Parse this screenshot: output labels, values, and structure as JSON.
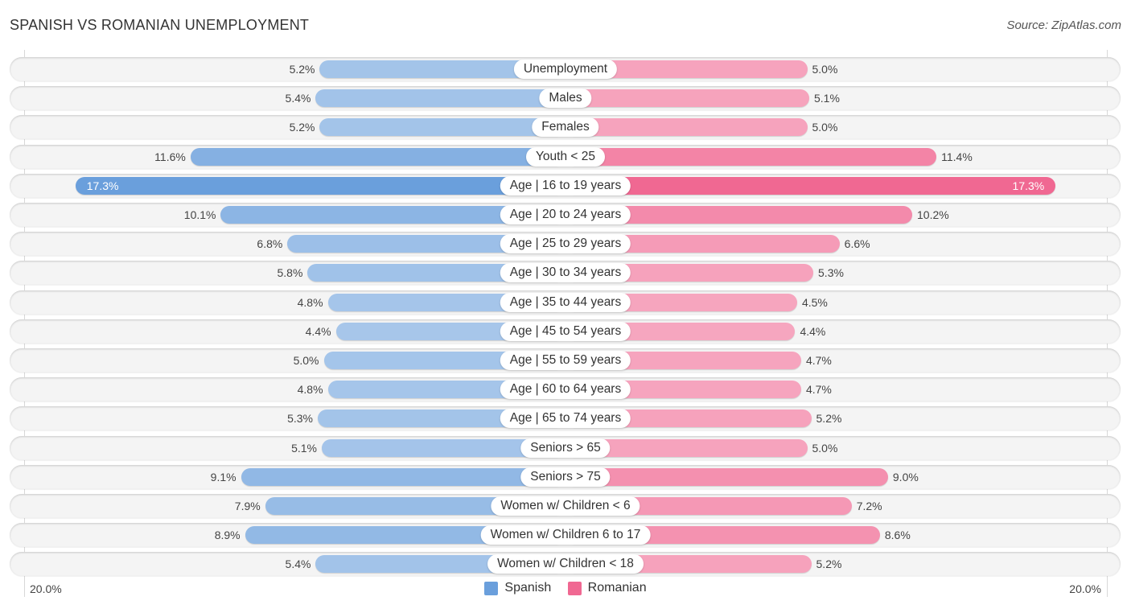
{
  "header": {
    "title": "SPANISH VS ROMANIAN UNEMPLOYMENT",
    "source": "Source: ZipAtlas.com"
  },
  "chart_data": {
    "type": "bar",
    "orientation": "horizontal-diverging",
    "title": "SPANISH VS ROMANIAN UNEMPLOYMENT",
    "xlabel": "",
    "ylabel": "",
    "xlim": [
      0,
      20.0
    ],
    "unit": "%",
    "axis_labels": {
      "left": "20.0%",
      "right": "20.0%"
    },
    "legend_position": "bottom-center",
    "categories": [
      "Unemployment",
      "Males",
      "Females",
      "Youth < 25",
      "Age | 16 to 19 years",
      "Age | 20 to 24 years",
      "Age | 25 to 29 years",
      "Age | 30 to 34 years",
      "Age | 35 to 44 years",
      "Age | 45 to 54 years",
      "Age | 55 to 59 years",
      "Age | 60 to 64 years",
      "Age | 65 to 74 years",
      "Seniors > 65",
      "Seniors > 75",
      "Women w/ Children < 6",
      "Women w/ Children 6 to 17",
      "Women w/ Children < 18"
    ],
    "series": [
      {
        "name": "Spanish",
        "color": "#6a9fdc",
        "side": "left",
        "values": [
          5.2,
          5.4,
          5.2,
          11.6,
          17.3,
          10.1,
          6.8,
          5.8,
          4.8,
          4.4,
          5.0,
          4.8,
          5.3,
          5.1,
          9.1,
          7.9,
          8.9,
          5.4
        ]
      },
      {
        "name": "Romanian",
        "color": "#f06892",
        "side": "right",
        "values": [
          5.0,
          5.1,
          5.0,
          11.4,
          17.3,
          10.2,
          6.6,
          5.3,
          4.5,
          4.4,
          4.7,
          4.7,
          5.2,
          5.0,
          9.0,
          7.2,
          8.6,
          5.2
        ]
      }
    ]
  },
  "legend": {
    "items": [
      {
        "label": "Spanish",
        "color": "#6a9fdc"
      },
      {
        "label": "Romanian",
        "color": "#f06892"
      }
    ]
  }
}
